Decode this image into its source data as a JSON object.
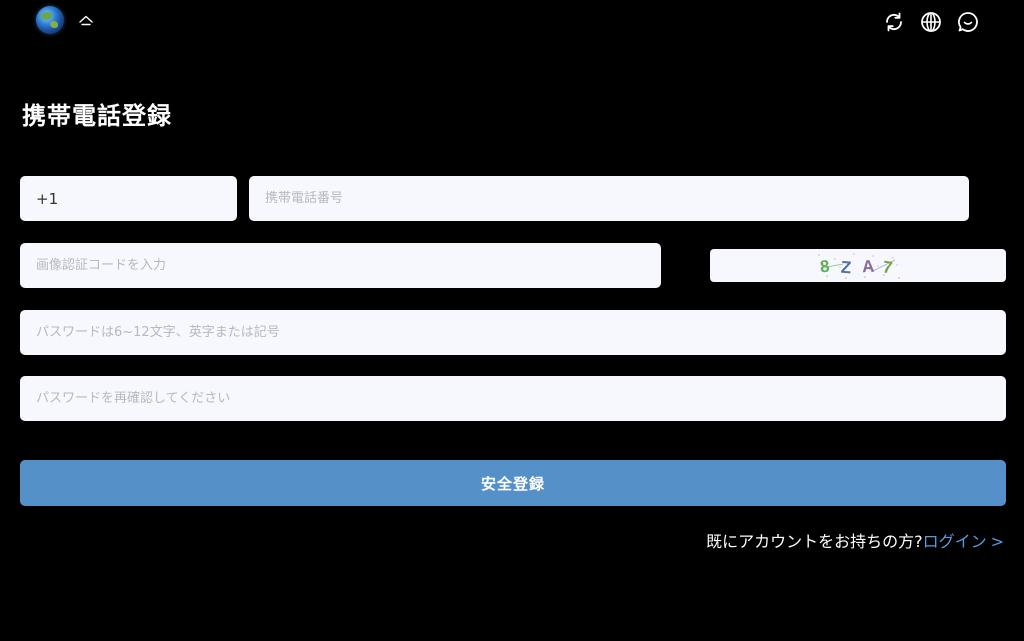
{
  "header": {
    "left_icons": [
      "globe-logo",
      "home-icon"
    ],
    "right_icons": [
      "refresh-icon",
      "language-icon",
      "chat-icon"
    ]
  },
  "page_title": "携帯電話登録",
  "form": {
    "country_code_value": "+1",
    "phone_placeholder": "携帯電話番号",
    "captcha_placeholder": "画像認証コードを入力",
    "captcha_text": "8ZA7",
    "password_placeholder": "パスワードは6~12文字、英字または記号",
    "password_confirm_placeholder": "パスワードを再確認してください",
    "submit_label": "安全登録"
  },
  "login": {
    "prompt": "既にアカウントをお持ちの方?",
    "link_label": "ログイン",
    "arrow": ">"
  },
  "colors": {
    "background": "#000000",
    "field_background": "#f7f8fd",
    "primary_button": "#5590c8",
    "link": "#5a9be0"
  }
}
